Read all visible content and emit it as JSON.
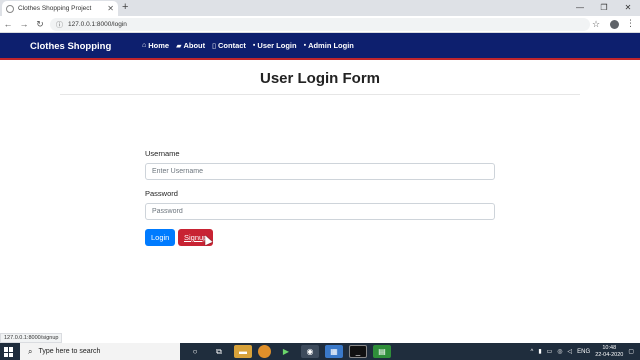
{
  "browser": {
    "tab_title": "Clothes Shopping Project",
    "url": "127.0.0.1:8000/login",
    "status_url": "127.0.0.1:8000/signup"
  },
  "navbar": {
    "brand": "Clothes Shopping",
    "links": [
      {
        "label": "Home",
        "icon": "home-icon"
      },
      {
        "label": "About",
        "icon": "briefcase-icon"
      },
      {
        "label": "Contact",
        "icon": "phone-icon"
      },
      {
        "label": "User Login",
        "icon": "user-icon"
      },
      {
        "label": "Admin Login",
        "icon": "user-icon"
      }
    ],
    "colors": {
      "background": "#0d1f6e",
      "border": "#c0262c"
    }
  },
  "page": {
    "title": "User Login Form",
    "username_label": "Username",
    "username_placeholder": "Enter Username",
    "password_label": "Password",
    "password_placeholder": "Password",
    "login_button": "Login",
    "signup_button": "Signup"
  },
  "taskbar": {
    "search_placeholder": "Type here to search",
    "language": "ENG",
    "time": "10:48",
    "date": "22-04-2020"
  }
}
